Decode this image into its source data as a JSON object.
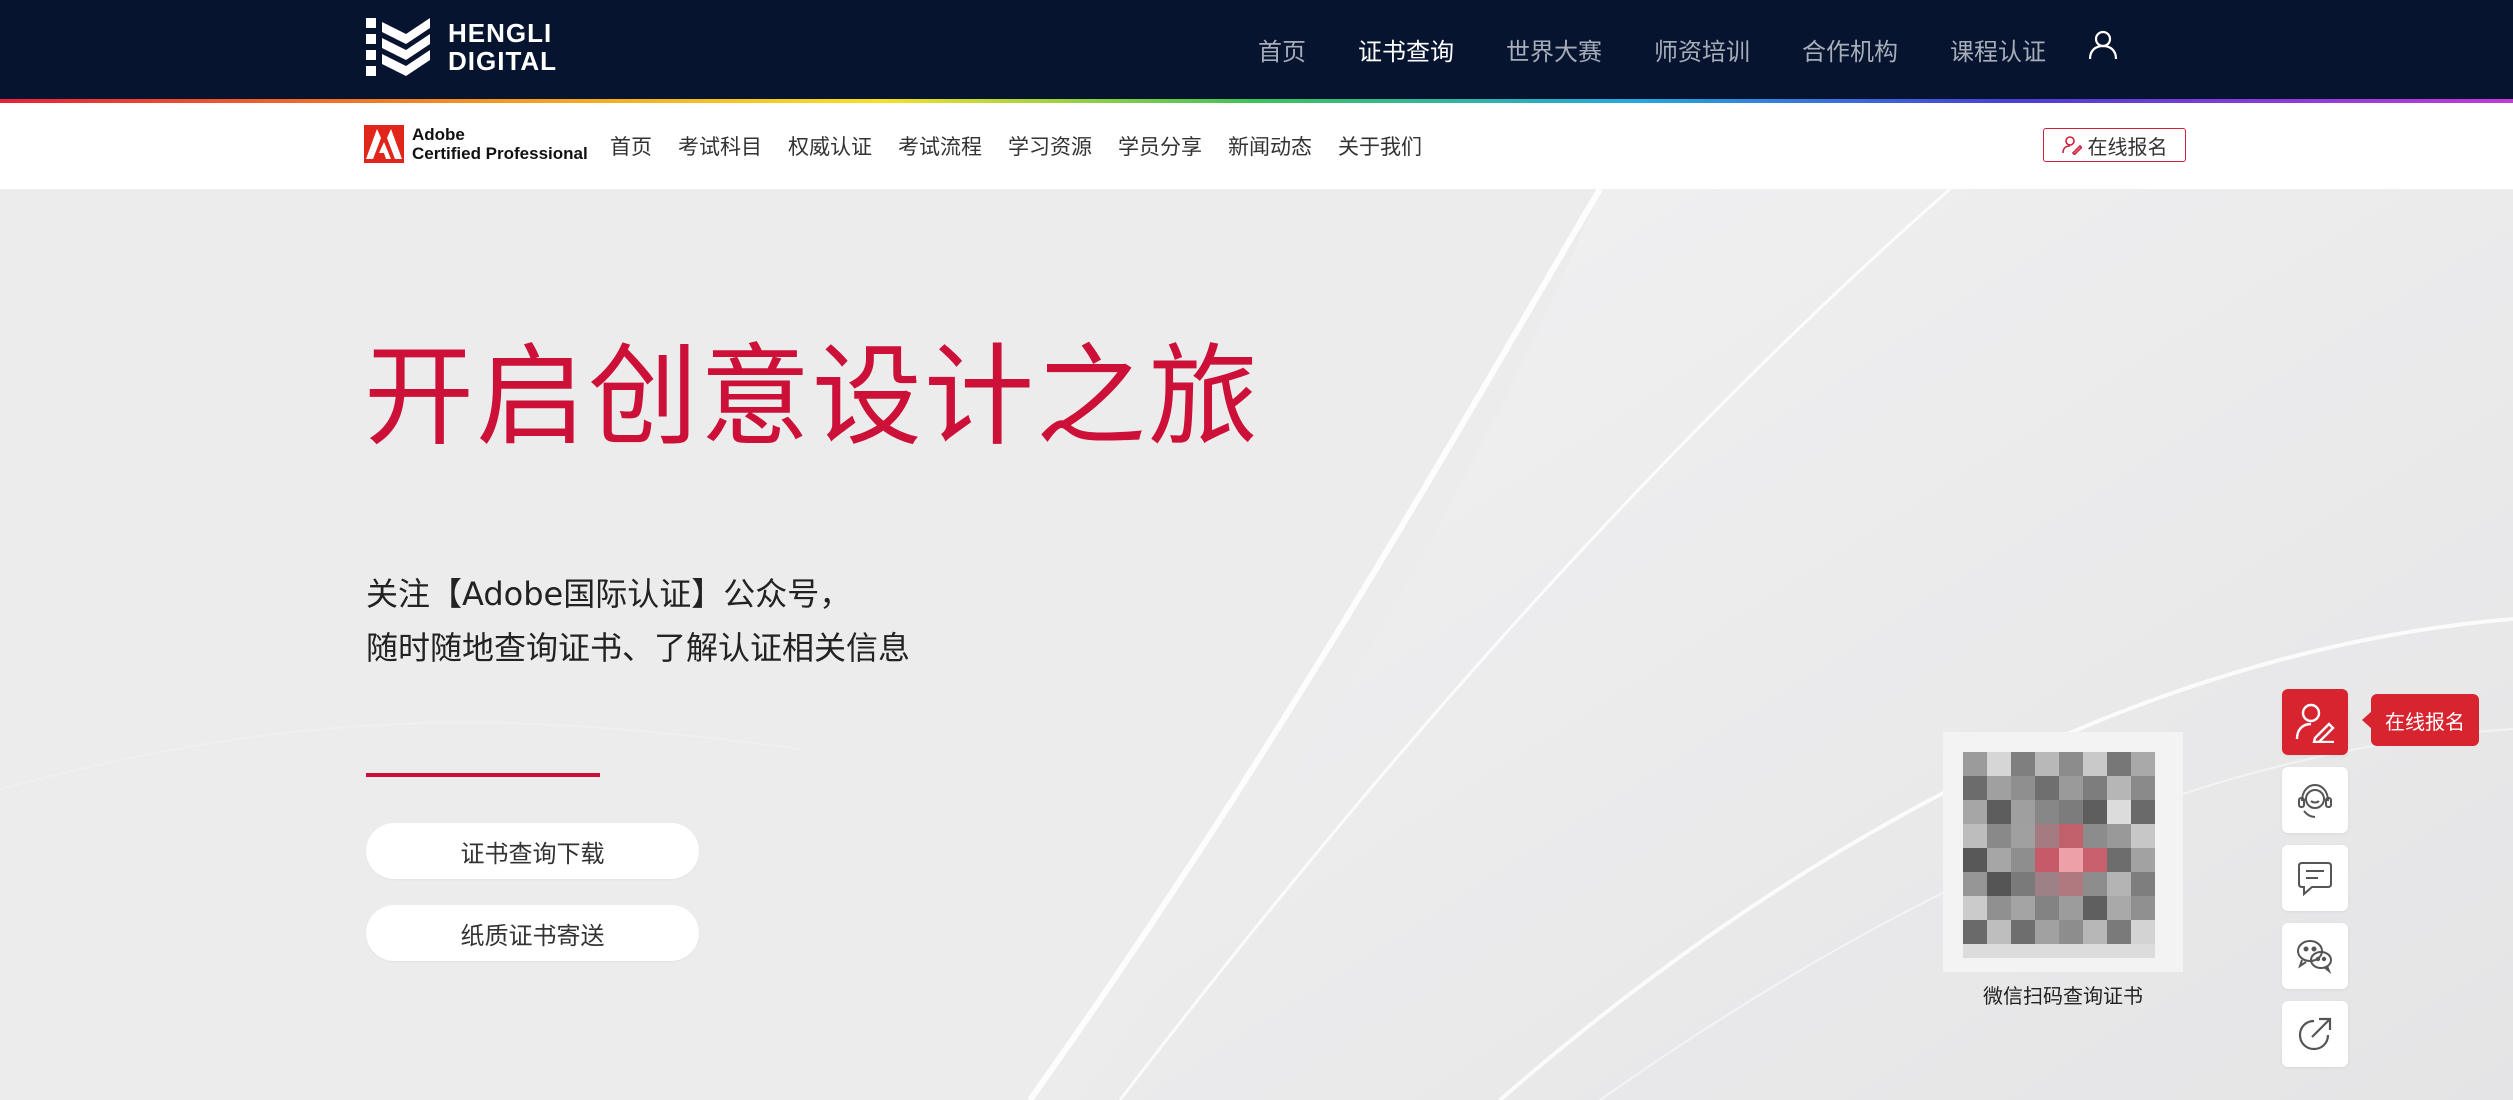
{
  "header": {
    "brand": {
      "line1": "HENGLI",
      "line2": "DIGITAL"
    },
    "nav": [
      {
        "label": "首页",
        "active": false
      },
      {
        "label": "证书查询",
        "active": true
      },
      {
        "label": "世界大赛",
        "active": false
      },
      {
        "label": "师资培训",
        "active": false
      },
      {
        "label": "合作机构",
        "active": false
      },
      {
        "label": "课程认证",
        "active": false
      }
    ],
    "user_icon": "user-icon"
  },
  "subnav": {
    "logo": {
      "line1": "Adobe",
      "line2": "Certified Professional"
    },
    "items": [
      "首页",
      "考试科目",
      "权威认证",
      "考试流程",
      "学习资源",
      "学员分享",
      "新闻动态",
      "关于我们"
    ],
    "register_label": "在线报名"
  },
  "hero": {
    "title": "开启创意设计之旅",
    "desc_line1": "关注【Adobe国际认证】公众号，",
    "desc_line2": "随时随地查询证书、了解认证相关信息",
    "btn_download": "证书查询下载",
    "btn_mail": "纸质证书寄送",
    "qr_caption": "微信扫码查询证书"
  },
  "sidebar": {
    "tooltip": "在线报名",
    "icons": [
      "register-icon",
      "customer-service-icon",
      "message-icon",
      "wechat-icon",
      "share-icon"
    ]
  },
  "colors": {
    "topbar": "#07142f",
    "accent": "#cc1038",
    "side_accent": "#d8242f"
  }
}
